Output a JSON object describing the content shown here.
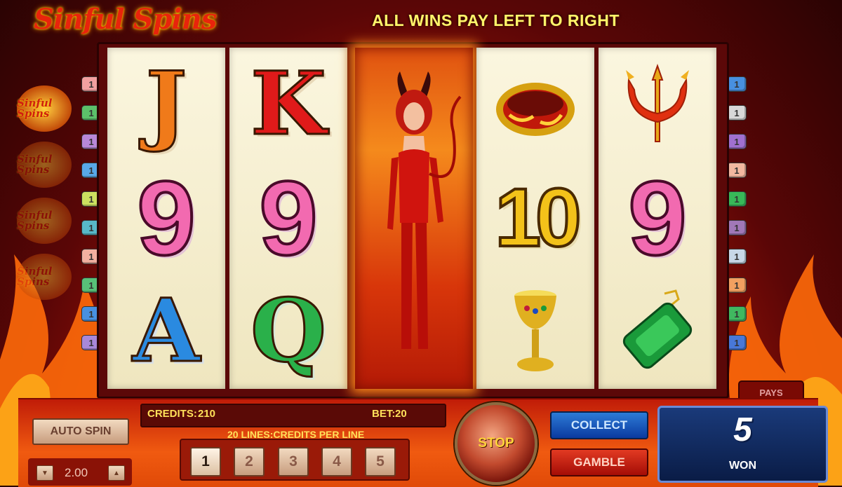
{
  "game": {
    "logo_text": "Sinful Spins",
    "headline": "ALL WINS PAY LEFT TO RIGHT"
  },
  "side_logos": [
    "Sinful Spins",
    "Sinful Spins",
    "Sinful Spins",
    "Sinful Spins"
  ],
  "reels": [
    {
      "symbols": [
        "J",
        "9",
        "A"
      ]
    },
    {
      "symbols": [
        "K",
        "9",
        "Q"
      ]
    },
    {
      "symbols": [
        "devil-wild"
      ]
    },
    {
      "symbols": [
        "ring",
        "10",
        "goblet"
      ]
    },
    {
      "symbols": [
        "trident",
        "9",
        "emerald"
      ]
    }
  ],
  "line_markers": {
    "left": [
      "1",
      "1",
      "1",
      "1",
      "1",
      "1",
      "1",
      "1",
      "1",
      "1"
    ],
    "right": [
      "1",
      "1",
      "1",
      "1",
      "1",
      "1",
      "1",
      "1",
      "1",
      "1"
    ]
  },
  "controls": {
    "auto_spin": "AUTO SPIN",
    "stake_value": "2.00",
    "credits_label": "CREDITS:",
    "credits_value": "210",
    "bet_label": "BET:",
    "bet_value": "20",
    "lines_label": "20 LINES:CREDITS PER LINE",
    "line_options": [
      "1",
      "2",
      "3",
      "4",
      "5"
    ],
    "selected_line": "1",
    "stop": "STOP",
    "collect": "COLLECT",
    "gamble": "GAMBLE",
    "pays": "PAYS",
    "won_value": "5",
    "won_label": "WON"
  },
  "colors": {
    "accent_yellow": "#ffe15a",
    "collect_blue": "#1a5cc0",
    "gamble_red": "#c41a0e"
  }
}
